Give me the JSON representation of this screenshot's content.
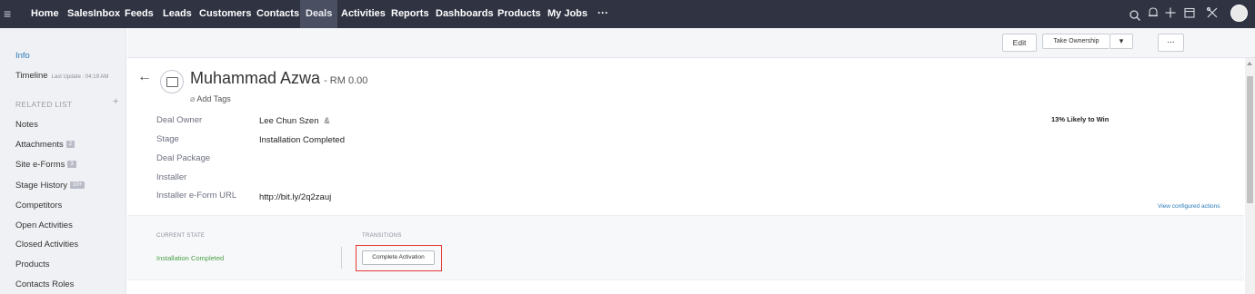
{
  "nav": {
    "menu_icon": "hamburger-icon",
    "items": [
      "Home",
      "SalesInbox",
      "Feeds",
      "Leads",
      "Customers",
      "Contacts",
      "Deals",
      "Activities",
      "Reports",
      "Dashboards",
      "Products",
      "My Jobs"
    ],
    "active": "Deals",
    "more": "···",
    "right_icons": [
      "search-icon",
      "bell-icon",
      "plus-icon",
      "calendar-icon",
      "tools-icon",
      "avatar"
    ]
  },
  "toolbar": {
    "edit": "Edit",
    "take_ownership": "Take Ownership",
    "dropdown": "▾",
    "more": "..."
  },
  "sidebar": {
    "info": "Info",
    "timeline": "Timeline",
    "timeline_sub": "Last Update : 04:19 AM",
    "related_header": "RELATED LIST",
    "related_plus": "+",
    "items": [
      {
        "label": "Notes",
        "badge": ""
      },
      {
        "label": "Attachments",
        "badge": "2"
      },
      {
        "label": "Site e-Forms",
        "badge": "3"
      },
      {
        "label": "Stage History",
        "badge": "10+"
      },
      {
        "label": "Competitors",
        "badge": ""
      },
      {
        "label": "Open Activities",
        "badge": ""
      },
      {
        "label": "Closed Activities",
        "badge": ""
      },
      {
        "label": "Products",
        "badge": ""
      },
      {
        "label": "Contacts Roles",
        "badge": ""
      }
    ]
  },
  "record": {
    "name": "Muhammad Azwa",
    "amount": "- RM 0.00",
    "add_tags": "Add Tags",
    "likely": "13% Likely to Win",
    "view_actions": "View configured actions",
    "fields": [
      {
        "label": "Deal Owner",
        "value": "Lee Chun Szen"
      },
      {
        "label": "Stage",
        "value": "Installation Completed"
      },
      {
        "label": "Deal Package",
        "value": ""
      },
      {
        "label": "Installer",
        "value": ""
      },
      {
        "label": "Installer e-Form URL",
        "value": "http://bit.ly/2q2zauj"
      }
    ]
  },
  "blueprint": {
    "current_state_label": "CURRENT STATE",
    "transitions_label": "TRANSITIONS",
    "current_state": "Installation Completed",
    "transition_button": "Complete Activation",
    "highlight_color": "#e53935",
    "state_color": "#4aa046"
  },
  "colors": {
    "nav_bg": "#2f3342",
    "nav_active": "#4a4f61",
    "link": "#2a7ab8",
    "sidebar_bg": "#f0f1f4"
  }
}
